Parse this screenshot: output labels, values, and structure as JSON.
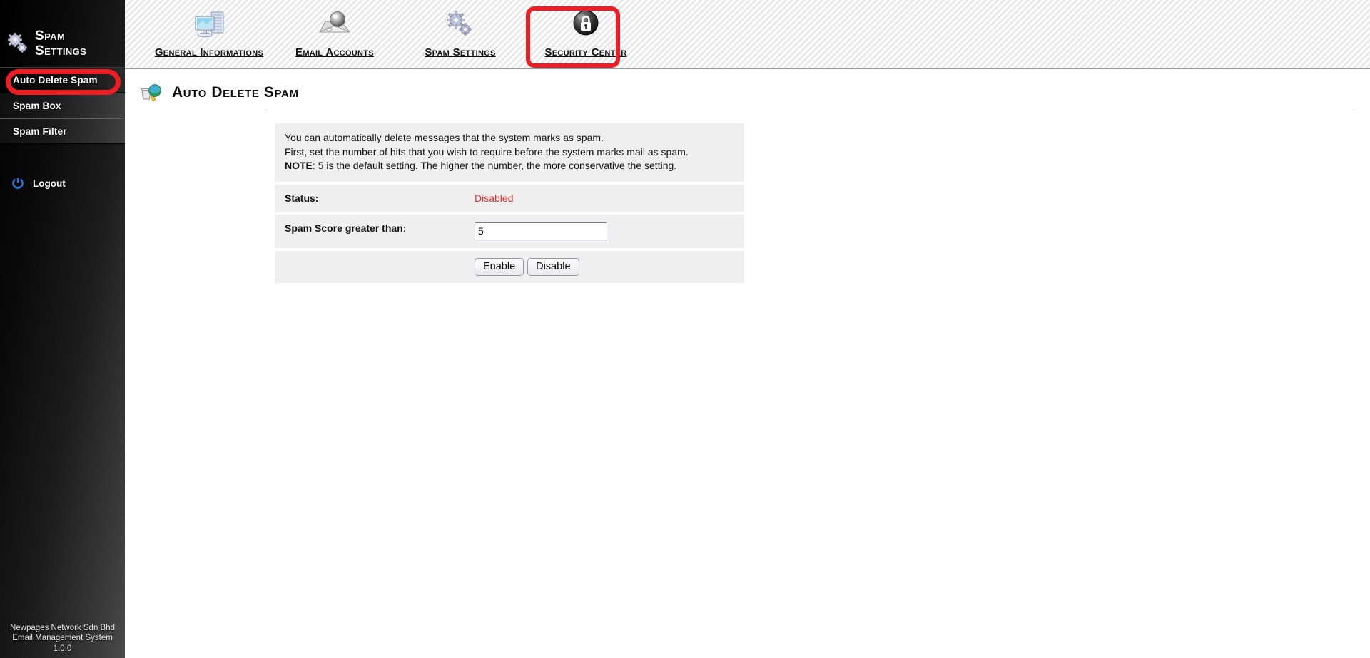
{
  "sidebar": {
    "brand": {
      "icon": "gears-icon",
      "line1": "Spam",
      "line2": "Settings"
    },
    "items": [
      {
        "label": "Auto Delete Spam",
        "selected": true
      },
      {
        "label": "Spam Box",
        "selected": false
      },
      {
        "label": "Spam Filter",
        "selected": false
      }
    ],
    "logout": {
      "icon": "power-icon",
      "label": "Logout"
    },
    "footer": {
      "line1": "Newpages Network Sdn Bhd",
      "line2": "Email Management System",
      "line3": "1.0.0"
    }
  },
  "topbar": {
    "tabs": [
      {
        "label": "General Informations",
        "icon": "computer-server-icon",
        "active": false
      },
      {
        "label": "Email Accounts",
        "icon": "envelope-sphere-icon",
        "active": false
      },
      {
        "label": "Spam Settings",
        "icon": "gears-icon",
        "active": true
      },
      {
        "label": "Security Center",
        "icon": "lock-shield-icon",
        "active": false
      }
    ]
  },
  "page": {
    "icon": "globe-trash-icon",
    "title": "Auto Delete Spam",
    "description": {
      "line1": "You can automatically delete messages that the system marks as spam.",
      "line2": "First, set the number of hits that you wish to require before the system marks mail as spam.",
      "note_label": "NOTE",
      "note_rest": ": 5 is the default setting. The higher the number, the more conservative the setting."
    },
    "fields": [
      {
        "label": "Status:",
        "value": "Disabled",
        "type": "status"
      },
      {
        "label": "Spam Score greater than:",
        "value": "5",
        "type": "input"
      }
    ],
    "buttons": [
      {
        "label": "Enable"
      },
      {
        "label": "Disable"
      }
    ]
  },
  "colors": {
    "annotation": "#ee1c23",
    "status_disabled": "#e03030",
    "panel_bg": "#efefef"
  }
}
